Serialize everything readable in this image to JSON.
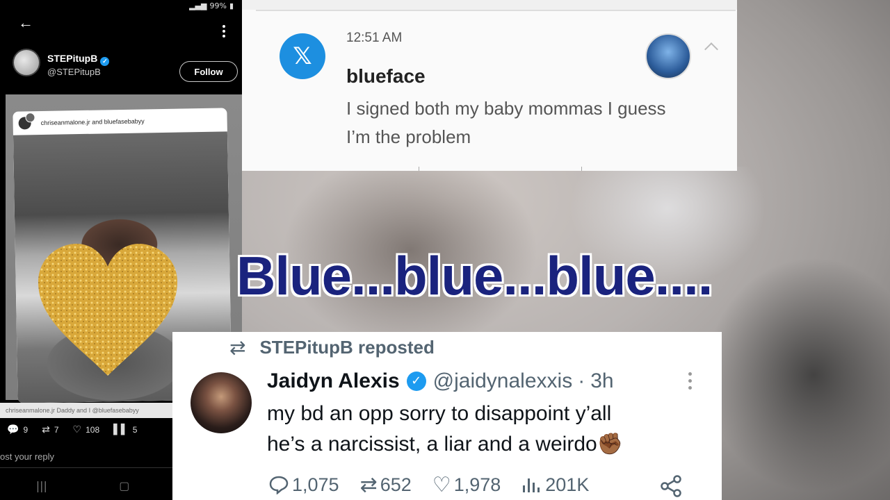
{
  "phone": {
    "status": {
      "battery": "99%"
    },
    "profile": {
      "name": "STEPitupB",
      "handle": "@STEPitupB",
      "follow_label": "Follow"
    },
    "post": {
      "users": "chriseanmalone.jr and bluefasebabyy",
      "caption": "chriseanmalone.jr Daddy and I @bluefasebabyy"
    },
    "actions": {
      "replies": "9",
      "reposts": "7",
      "likes": "108",
      "views": "5"
    },
    "reply_placeholder": "ost your reply"
  },
  "notification": {
    "time": "12:51 AM",
    "sender": "blueface",
    "body_line1": "I signed both my baby mommas I guess",
    "body_line2": "I’m the problem",
    "app_icon": "x-logo-icon"
  },
  "headline": "Blue...blue...blue....",
  "tweet": {
    "reposted_by": "STEPitupB reposted",
    "name": "Jaidyn Alexis",
    "handle": "@jaidynalexxis",
    "separator": "·",
    "time": "3h",
    "text_line1": "my bd an opp sorry to disappoint y’all",
    "text_line2": "he’s a narcissist, a liar and a weirdo✊🏾",
    "replies": "1,075",
    "reposts": "652",
    "likes": "1,978",
    "views": "201K"
  },
  "colors": {
    "x_blue": "#1d8fe0",
    "verified": "#1d9bf0",
    "headline": "#1a237e",
    "muted": "#536471"
  }
}
